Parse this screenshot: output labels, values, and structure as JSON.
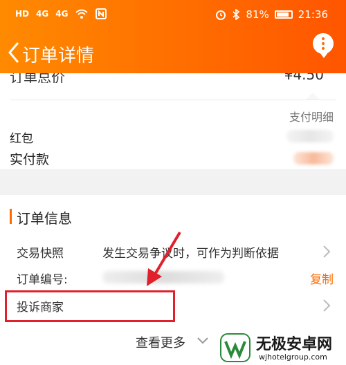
{
  "status_bar": {
    "left_badges": [
      "HD",
      "4G",
      "4G"
    ],
    "battery": "81%",
    "time": "21:36"
  },
  "nav": {
    "title": "订单详情",
    "back_icon": "chevron-left-icon",
    "more_icon": "more-vertical-icon"
  },
  "payment": {
    "total_label": "订单总价",
    "total_value": "¥4.50",
    "detail_link": "支付明细",
    "red_packet_label": "红包",
    "paid_label": "实付款"
  },
  "order_info": {
    "section_title": "订单信息",
    "rows": [
      {
        "label": "交易快照",
        "value": "发生交易争议时，可作为判断依据"
      },
      {
        "label": "订单编号:",
        "action": "复制"
      },
      {
        "label": "投诉商家"
      }
    ],
    "see_more": "查看更多"
  },
  "watermark": {
    "title": "无极安卓网",
    "url": "wjhotelgroup.com"
  },
  "colors": {
    "brand_orange": "#ff6a00",
    "highlight_red": "#e0202a"
  }
}
